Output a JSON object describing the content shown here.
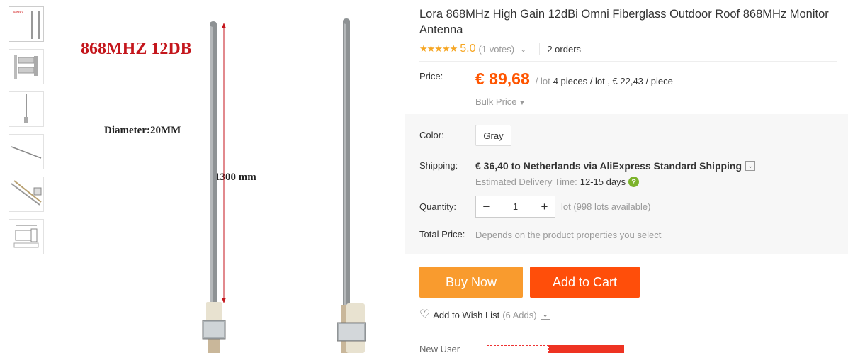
{
  "product": {
    "title": "Lora 868MHz High Gain 12dBi Omni Fiberglass Outdoor Roof 868MHz Monitor Antenna",
    "rating_stars": "★★★★★",
    "rating_score": "5.0",
    "votes": "(1 votes)",
    "orders": "2 orders"
  },
  "image": {
    "headline": "868MHZ 12DB",
    "diameter": "Diameter:20MM",
    "length": "1300 mm"
  },
  "price": {
    "label": "Price:",
    "value": "€ 89,68",
    "per_lot": "/ lot",
    "lot_detail": "4 pieces / lot , € 22,43 / piece",
    "bulk": "Bulk Price"
  },
  "color": {
    "label": "Color:",
    "selected": "Gray"
  },
  "shipping": {
    "label": "Shipping:",
    "text": "€ 36,40 to Netherlands via AliExpress Standard Shipping",
    "delivery_label": "Estimated Delivery Time:",
    "delivery_days": "12-15 days"
  },
  "quantity": {
    "label": "Quantity:",
    "value": "1",
    "available": "lot (998 lots available)"
  },
  "total": {
    "label": "Total Price:",
    "value": "Depends on the product properties you select"
  },
  "actions": {
    "buy_now": "Buy Now",
    "add_to_cart": "Add to Cart",
    "wishlist": "Add to Wish List",
    "wishlist_adds": "(6 Adds)"
  },
  "promo": {
    "new_user": "New User"
  },
  "colors": {
    "price": "#ff5500",
    "buy_now": "#f99b2e",
    "add_to_cart": "#ff4e0a",
    "star": "#f6a623"
  }
}
